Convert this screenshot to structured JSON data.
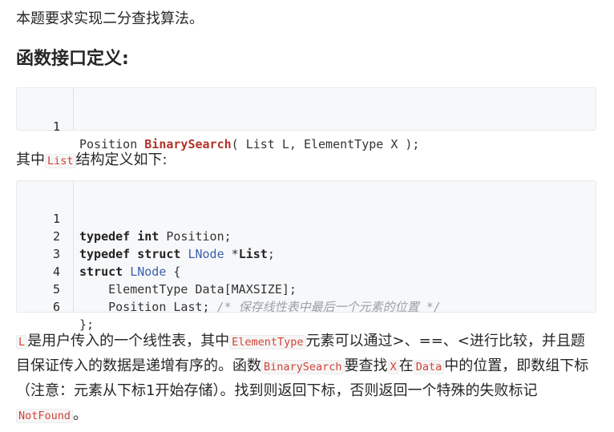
{
  "intro": "本题要求实现二分查找算法。",
  "heading": "函数接口定义:",
  "interface_code": {
    "line_no": "1",
    "ret_type": "Position ",
    "func_name": "BinarySearch",
    "params": "( List L, ElementType X );"
  },
  "list_sentence": {
    "prefix": "其中",
    "code": "List",
    "suffix": "结构定义如下:"
  },
  "struct_code": {
    "line_nos": [
      "1",
      "2",
      "3",
      "4",
      "5",
      "6"
    ],
    "l1": {
      "kw1": "typedef",
      "kw2": "int",
      "rest": " Position;"
    },
    "l2": {
      "kw1": "typedef",
      "kw2": "struct",
      "type": "LNode",
      "star": " *",
      "name": "List",
      "semi": ";"
    },
    "l3": {
      "kw1": "struct",
      "type": "LNode",
      "rest": " {"
    },
    "l4": {
      "text": "    ElementType Data[MAXSIZE];"
    },
    "l5": {
      "text": "    Position Last; ",
      "comment": "/* 保存线性表中最后一个元素的位置 */"
    },
    "l6": {
      "text": "};"
    }
  },
  "description": {
    "c1": "L",
    "t1": "是用户传入的一个线性表，其中",
    "c2": "ElementType",
    "t2": "元素可以通过>、==、<进行比较，并且题目保证传入的数据是递增有序的。函数",
    "c3": "BinarySearch",
    "t3": "要查找",
    "c4": "X",
    "t4": "在",
    "c5": "Data",
    "t5": "中的位置，即数组下标（注意：元素从下标1开始存储）。找到则返回下标，否则返回一个特殊的失败标记",
    "c6": "NotFound",
    "t6": "。"
  }
}
